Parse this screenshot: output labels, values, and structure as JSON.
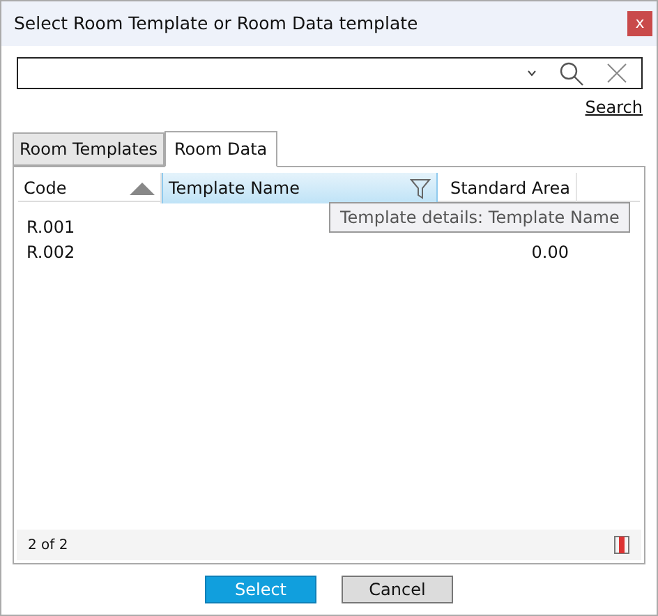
{
  "window": {
    "title": "Select Room Template or Room Data template",
    "close": "x"
  },
  "search": {
    "link": "Search"
  },
  "tabs": [
    {
      "label": "Room Templates",
      "selected": false
    },
    {
      "label": "Room Data",
      "selected": true
    }
  ],
  "table": {
    "columns": [
      {
        "label": "Code",
        "sorted": true,
        "highlighted": false
      },
      {
        "label": "Template Name",
        "sorted": false,
        "highlighted": true
      },
      {
        "label": "Standard Area",
        "sorted": false,
        "highlighted": false
      }
    ],
    "rows": [
      [
        "R.001",
        "",
        ""
      ],
      [
        "R.002",
        "",
        "0.00"
      ]
    ]
  },
  "tooltip": "Template details: Template Name",
  "status": "2 of 2",
  "buttons": [
    {
      "label": "Select",
      "primary": true
    },
    {
      "label": "Cancel",
      "primary": false
    }
  ]
}
